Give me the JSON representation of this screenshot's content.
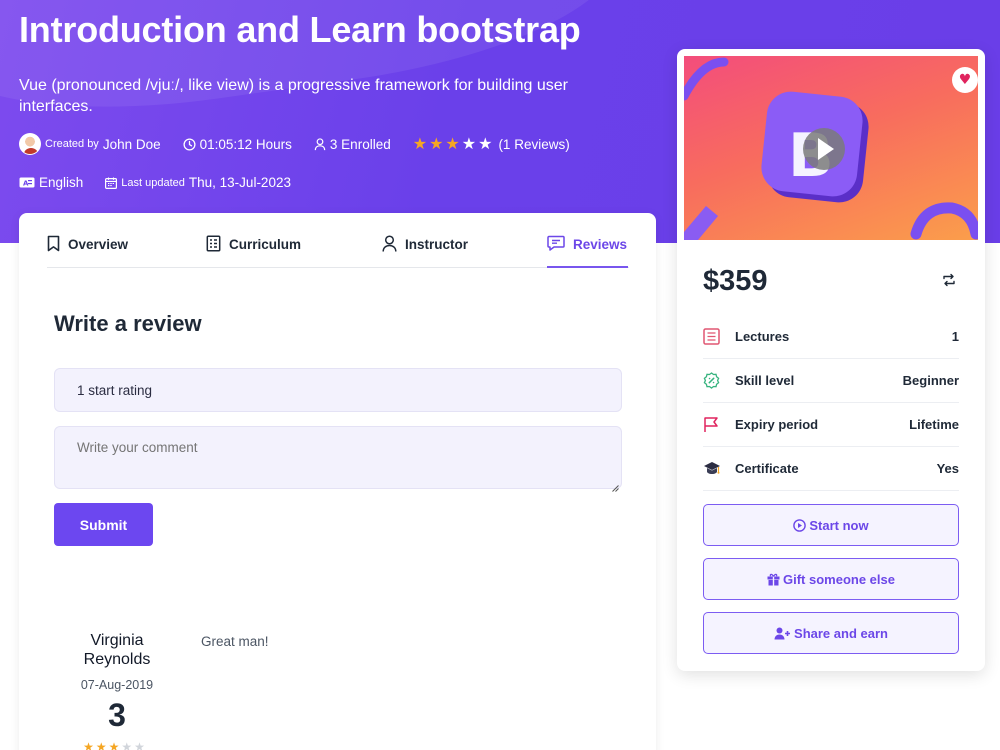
{
  "course": {
    "title": "Introduction and Learn bootstrap",
    "description": "Vue (pronounced /vjuː/, like view) is a progressive framework for building user interfaces.",
    "created_by_label": "Created by",
    "author": "John Doe",
    "duration": "01:05:12 Hours",
    "enrolled": "3 Enrolled",
    "rating_stars": 3,
    "rating_max": 5,
    "reviews_count": "(1 Reviews)",
    "language": "English",
    "last_updated_label": "Last updated",
    "last_updated": "Thu, 13-Jul-2023"
  },
  "tabs": [
    {
      "label": "Overview",
      "icon": "bookmark-icon",
      "active": false
    },
    {
      "label": "Curriculum",
      "icon": "list-document-icon",
      "active": false
    },
    {
      "label": "Instructor",
      "icon": "user-icon",
      "active": false
    },
    {
      "label": "Reviews",
      "icon": "chat-icon",
      "active": true
    }
  ],
  "review_form": {
    "heading": "Write a review",
    "rating_value": "1 start rating",
    "comment_placeholder": "Write your comment",
    "submit_label": "Submit"
  },
  "reviews": [
    {
      "name": "Virginia Reynolds",
      "date": "07-Aug-2019",
      "score": "3",
      "stars": 3,
      "text": "Great man!"
    }
  ],
  "sidebar": {
    "price": "$359",
    "details": [
      {
        "label": "Lectures",
        "value": "1",
        "icon": "lectures-icon"
      },
      {
        "label": "Skill level",
        "value": "Beginner",
        "icon": "skill-level-icon"
      },
      {
        "label": "Expiry period",
        "value": "Lifetime",
        "icon": "flag-icon"
      },
      {
        "label": "Certificate",
        "value": "Yes",
        "icon": "graduation-cap-icon"
      }
    ],
    "actions": [
      {
        "label": "Start now",
        "icon": "play-circle-icon"
      },
      {
        "label": "Gift someone else",
        "icon": "gift-icon"
      },
      {
        "label": "Share and earn",
        "icon": "user-plus-icon"
      }
    ]
  },
  "colors": {
    "hero": "#6a40ea",
    "accent": "#6c47e8",
    "star": "#f5a623"
  }
}
